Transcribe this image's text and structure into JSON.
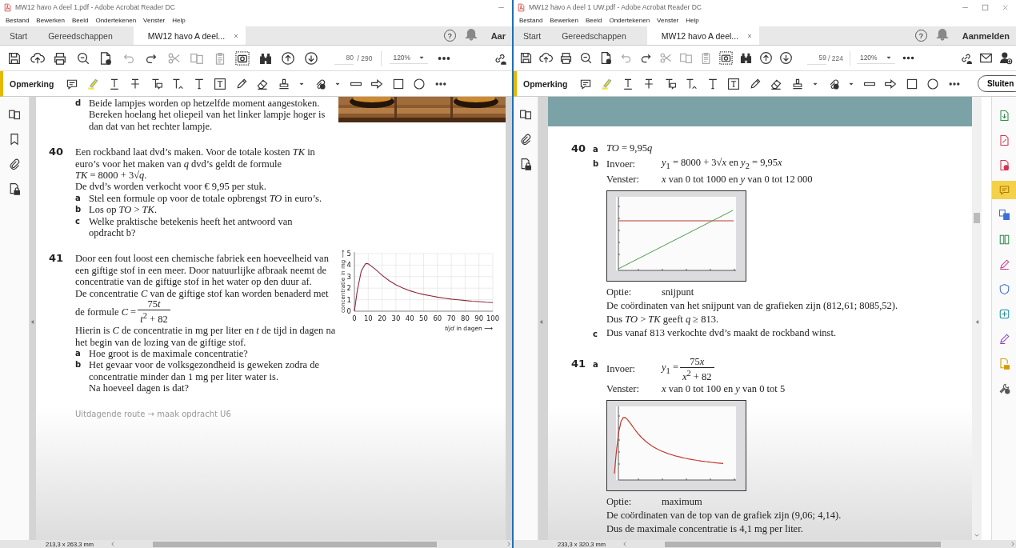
{
  "windows": [
    {
      "title": "MW12 havo A deel 1.pdf - Adobe Acrobat Reader DC",
      "menu": [
        "Bestand",
        "Bewerken",
        "Beeld",
        "Ondertekenen",
        "Venster",
        "Help"
      ],
      "tabs": [
        {
          "label": "Start",
          "selected": false
        },
        {
          "label": "Gereedschappen",
          "selected": false
        },
        {
          "label": "MW12 havo A deel...",
          "selected": true
        }
      ],
      "help_symbol": "?",
      "account_label": "Aar",
      "page_number": "80",
      "page_total": "/ 290",
      "zoom": "120%",
      "comment_label": "Opmerking",
      "page_size": "213,3 x 263,3 mm",
      "page": {
        "kind": "exercises",
        "top_part": {
          "letter": "d",
          "text": "Beide lampjes worden op hetzelfde moment aangestoken. Bereken hoelang het oliepeil van het linker lampje hoger is dan dat van het rechter lampje."
        },
        "exercises": [
          {
            "number": "40",
            "paragraphs": [
              {
                "kind": "text",
                "text": "Een rockband laat dvd’s maken. Voor de totale kosten *TK* in euro’s voor het maken van *q* dvd’s geldt de formule"
              },
              {
                "kind": "text",
                "text": "*TK* = 8000 + 3√*q*."
              },
              {
                "kind": "text",
                "text": "De dvd’s worden verkocht voor € 9,95 per stuk."
              }
            ],
            "parts": [
              {
                "letter": "a",
                "paragraphs": [
                  "Stel een formule op voor de totale opbrengst *TO* in euro’s."
                ]
              },
              {
                "letter": "b",
                "paragraphs": [
                  "Los op *TO* > *TK*."
                ]
              },
              {
                "letter": "c",
                "paragraphs": [
                  "Welke praktische betekenis heeft het antwoord van opdracht b?"
                ]
              }
            ]
          },
          {
            "number": "41",
            "paragraphs": [
              {
                "kind": "text",
                "text": "Door een fout loost een chemische fabriek een hoeveelheid van een giftige stof in een meer. Door natuurlijke afbraak neemt de concentratie van de giftige stof in het water op den duur af."
              },
              {
                "kind": "text",
                "text": "De concentratie *C* van de giftige stof kan worden benaderd met"
              },
              {
                "kind": "fraction",
                "prefix": "de formule *C* =",
                "numerator": [
                  "75",
                  "*t*"
                ],
                "denominator": "*t*$^{2}$ + 82"
              },
              {
                "kind": "text",
                "text": "Hierin is *C* de concentratie in mg per liter en *t* de tijd in dagen na het begin van de lozing van de giftige stof."
              }
            ],
            "parts": [
              {
                "letter": "a",
                "paragraphs": [
                  "Hoe groot is de maximale concentratie?"
                ]
              },
              {
                "letter": "b",
                "paragraphs": [
                  "Het gevaar voor de volksgezondheid is geweken zodra de concentratie minder dan 1 mg per liter water is.",
                  "Na hoeveel dagen is dat?"
                ]
              }
            ],
            "chart_data": {
              "type": "line",
              "xlabel": "*tijd* in dagen ⟶",
              "ylabel": "concentratie in mg ⟶",
              "x": [
                0,
                2,
                5,
                8,
                9,
                10,
                15,
                20,
                25,
                30,
                35,
                40,
                45,
                50,
                55,
                60,
                65,
                70,
                75,
                80,
                85,
                90,
                95,
                100
              ],
              "grid": true,
              "series": [
                {
                  "color": "#8e2a3c",
                  "values": [
                    0,
                    1.74,
                    3.5,
                    4.11,
                    4.14,
                    4.12,
                    3.66,
                    3.11,
                    2.65,
                    2.29,
                    2.01,
                    1.78,
                    1.6,
                    1.45,
                    1.33,
                    1.22,
                    1.13,
                    1.05,
                    0.99,
                    0.93,
                    0.87,
                    0.83,
                    0.78,
                    0.74
                  ]
                }
              ],
              "xlim": [
                0,
                100
              ],
              "ylim": [
                0,
                5
              ],
              "xticks": [
                0,
                10,
                20,
                30,
                40,
                50,
                60,
                70,
                80,
                90,
                100
              ],
              "yticks": [
                0,
                1,
                2,
                3,
                4,
                5
              ]
            }
          }
        ],
        "footer_link": "Uitdagende route → maak opdracht U6"
      }
    },
    {
      "title": "MW12 havo A deel 1 UW.pdf - Adobe Acrobat Reader DC",
      "menu": [
        "Bestand",
        "Bewerken",
        "Beeld",
        "Ondertekenen",
        "Venster",
        "Help"
      ],
      "tabs": [
        {
          "label": "Start",
          "selected": false
        },
        {
          "label": "Gereedschappen",
          "selected": false
        },
        {
          "label": "MW12 havo A deel...",
          "selected": true
        }
      ],
      "help_symbol": "?",
      "account_label": "Aanmelden",
      "page_number": "59",
      "page_total": "/ 224",
      "zoom": "120%",
      "comment_label": "Opmerking",
      "close_label": "Sluiten",
      "page_size": "233,3 x 320,3 mm",
      "tools_panel": {
        "tools": [
          {
            "selected": false
          },
          {
            "selected": false
          },
          {
            "selected": false
          },
          {
            "selected": true
          },
          {
            "selected": false
          },
          {
            "selected": false
          },
          {
            "selected": false
          },
          {
            "selected": false
          },
          {
            "selected": false
          },
          {
            "selected": false
          },
          {
            "selected": false
          },
          {
            "selected": false
          }
        ]
      },
      "page": {
        "kind": "answers",
        "answers": [
          {
            "number": "40",
            "parts": [
              {
                "letter": "a",
                "lines": [
                  {
                    "kind": "text",
                    "text": [
                      "*TO* = 9,95",
                      "*q*"
                    ]
                  }
                ]
              },
              {
                "letter": "b",
                "lines": [
                  {
                    "kind": "labeled",
                    "label": "Invoer:",
                    "text": [
                      "*y*$_{1}$ = 8000 + 3√*x* en *y*$_{2}$ = 9,95",
                      "*x*"
                    ]
                  },
                  {
                    "kind": "labeled",
                    "label": "Venster:",
                    "text": "*x* van 0 tot 1000 en *y* van 0 tot 12 000"
                  },
                  {
                    "kind": "intersection-graph"
                  },
                  {
                    "kind": "labeled",
                    "label": "Optie:",
                    "text": "snijpunt"
                  },
                  {
                    "kind": "text",
                    "text": "De coördinaten van het snijpunt van de grafieken zijn (812,61; 8085,52)."
                  },
                  {
                    "kind": "text",
                    "text": "Dus *TO* > *TK* geeft *q* ≥ 813."
                  }
                ]
              },
              {
                "letter": "c",
                "lines": [
                  {
                    "kind": "text",
                    "text": "Dus vanaf 813 verkochte dvd’s maakt de rockband winst."
                  }
                ]
              }
            ]
          },
          {
            "number": "41",
            "parts": [
              {
                "letter": "a",
                "lines": [
                  {
                    "kind": "fraction",
                    "label": "Invoer:",
                    "prefix": "*y*$_{1}$ =",
                    "numerator": [
                      "75",
                      "*x*"
                    ],
                    "denominator": "*x*$^{2}$ + 82"
                  },
                  {
                    "kind": "labeled",
                    "label": "Venster:",
                    "text": "*x* van 0 tot 100 en *y* van 0 tot 5"
                  },
                  {
                    "kind": "peak-graph"
                  },
                  {
                    "kind": "labeled",
                    "label": "Optie:",
                    "text": "maximum"
                  },
                  {
                    "kind": "text",
                    "text": "De coördinaten van de top van de grafiek zijn (9,06; 4,14)."
                  },
                  {
                    "kind": "text",
                    "text": "Dus de maximale concentratie is 4,1 mg per liter."
                  }
                ]
              }
            ]
          }
        ]
      }
    }
  ]
}
